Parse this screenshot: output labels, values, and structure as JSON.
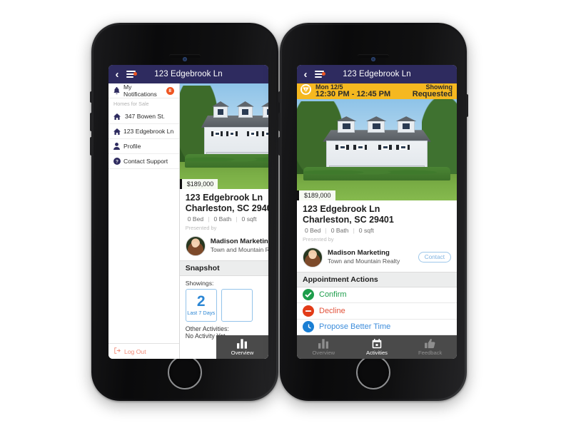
{
  "nav": {
    "title": "123 Edgebrook Ln",
    "back_icon": "chevron-left-icon",
    "menu_icon": "hamburger-menu-icon",
    "badge_visible": true
  },
  "drawer": {
    "notifications": {
      "label": "My Notifications",
      "badge": "8",
      "icon": "bell-icon"
    },
    "section_label": "Homes for Sale",
    "homes": [
      {
        "label": "347 Bowen St.",
        "icon": "home-icon"
      },
      {
        "label": "123 Edgebrook Ln",
        "icon": "home-icon"
      }
    ],
    "profile": {
      "label": "Profile",
      "icon": "person-icon"
    },
    "support": {
      "label": "Contact Support",
      "icon": "question-circle-icon"
    },
    "logout": {
      "label": "Log Out",
      "icon": "logout-icon"
    }
  },
  "listing": {
    "price": "$189,000",
    "address_line1": "123 Edgebrook Ln",
    "address_line2": "Charleston, SC 29401",
    "beds": "0 Bed",
    "baths": "0 Bath",
    "sqft": "0 sqft",
    "sep": "|",
    "presented_by": "Presented by",
    "agent_name": "Madison Marketing",
    "agent_company": "Town and Mountain Realty",
    "contact_label": "Contact"
  },
  "snapshot": {
    "header": "Snapshot",
    "showings_label": "Showings:",
    "tiles": [
      {
        "number": "2",
        "caption": "Last 7 Days"
      },
      {
        "number": "",
        "caption": ""
      }
    ],
    "other_activities_label": "Other Activities:",
    "other_activities_value": "No Activity Yet"
  },
  "appointment": {
    "day": "Mon 12/5",
    "time": "12:30 PM - 12:45 PM",
    "status_line1": "Showing",
    "status_line2": "Requested",
    "banner_color": "#f5b820",
    "alert_icon": "warning-triangle-icon"
  },
  "actions": {
    "header": "Appointment Actions",
    "items": [
      {
        "label": "Confirm",
        "icon": "check-circle-icon",
        "color": "#1d9d4b"
      },
      {
        "label": "Decline",
        "icon": "minus-circle-icon",
        "color": "#e23b17"
      },
      {
        "label": "Propose Better Time",
        "icon": "clock-icon",
        "color": "#1b7fd4"
      }
    ]
  },
  "tabbar_phone1": {
    "tabs": [
      {
        "label": "Overview",
        "icon": "bar-chart-icon",
        "active": true
      }
    ]
  },
  "tabbar_phone2": {
    "tabs": [
      {
        "label": "Overview",
        "icon": "bar-chart-icon",
        "active": false
      },
      {
        "label": "Activities",
        "icon": "calendar-icon",
        "active": true
      },
      {
        "label": "Feedback",
        "icon": "thumbs-up-icon",
        "active": false
      }
    ]
  },
  "theme": {
    "navbar": "#2e2b5f",
    "accent_orange": "#ef5622",
    "accent_blue": "#2b86d4",
    "tabbar": "#4a4a4a"
  }
}
